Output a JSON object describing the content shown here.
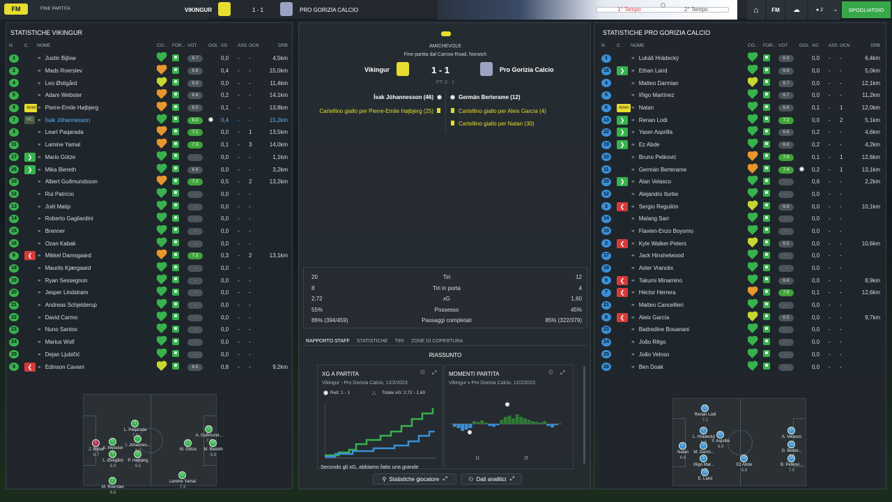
{
  "topbar": {
    "fm_badge": "FM",
    "status": "FINE PARTITA",
    "home_team": "VIKINGUR",
    "score": "1 - 1",
    "away_team": "PRO GORIZIA CALCIO",
    "first_half": "1° Tempo",
    "second_half": "2° Tempo",
    "fm_label": "FM",
    "people_count": "2",
    "dressing_room": "SPOGLIATOIO"
  },
  "columns": {
    "n": "N.",
    "c": "C",
    "name": "NOME",
    "co": "CO...",
    "form": "FOR...",
    "vot": "VOT",
    "gol": "GOL",
    "xg": "XG",
    "ass": "ASS",
    "ocn": "OCN",
    "drb": "DRB"
  },
  "left": {
    "title": "STATISTICHE VIKINGUR",
    "players": [
      {
        "n": "1",
        "name": "Justin Bijlow",
        "vot": "6.7",
        "rg": false,
        "gol": "",
        "xg": "0,0",
        "ass": "-",
        "ocn": "-",
        "drb": "4,5km",
        "heart": "g"
      },
      {
        "n": "2",
        "name": "Mads Roerslev",
        "vot": "6.8",
        "rg": false,
        "gol": "",
        "xg": "0,4",
        "ass": "-",
        "ocn": "-",
        "drb": "15,0km",
        "heart": "o"
      },
      {
        "n": "4",
        "name": "Leo Østigård",
        "vot": "6.9",
        "rg": false,
        "gol": "",
        "xg": "0,0",
        "ass": "-",
        "ocn": "-",
        "drb": "11,4km",
        "heart": "y"
      },
      {
        "n": "5",
        "name": "Adam Webster",
        "vot": "6.6",
        "rg": false,
        "gol": "",
        "xg": "0,2",
        "ass": "-",
        "ocn": "-",
        "drb": "14,1km",
        "heart": "o"
      },
      {
        "n": "8",
        "tag": "Amm",
        "name": "Pierre-Emile Højbjerg",
        "vot": "6.5",
        "rg": false,
        "gol": "",
        "xg": "0,1",
        "ass": "-",
        "ocn": "-",
        "drb": "13,8km",
        "heart": "o"
      },
      {
        "n": "7",
        "tagg": "MC",
        "name": "Ísak Jóhannesson",
        "vot": "8.0",
        "rg": true,
        "gol": "1",
        "xg": "0,4",
        "ass": "-",
        "ocn": "-",
        "drb": "15,2km",
        "heart": "g",
        "hl": true
      },
      {
        "n": "3",
        "name": "Leart Paqarada",
        "vot": "7.1",
        "rg": true,
        "gol": "",
        "xg": "0,0",
        "ass": "-",
        "ocn": "1",
        "drb": "13,5km",
        "heart": "o"
      },
      {
        "n": "11",
        "name": "Lamine Yamal",
        "vot": "7.3",
        "rg": true,
        "gol": "",
        "xg": "0,1",
        "ass": "-",
        "ocn": "3",
        "drb": "14,0km",
        "heart": "o"
      },
      {
        "n": "17",
        "sub": "in",
        "name": "Mario Götze",
        "vot": "-",
        "rg": false,
        "gol": "",
        "xg": "0,0",
        "ass": "-",
        "ocn": "-",
        "drb": "1,1km",
        "heart": "g"
      },
      {
        "n": "26",
        "sub": "in",
        "name": "Mika Biereth",
        "vot": "6.6",
        "rg": false,
        "gol": "",
        "xg": "0,0",
        "ass": "-",
        "ocn": "-",
        "drb": "3,2km",
        "heart": "g"
      },
      {
        "n": "10",
        "name": "Albert Guðmundsson",
        "vot": "7.2",
        "rg": true,
        "gol": "",
        "xg": "0,5",
        "ass": "-",
        "ocn": "2",
        "drb": "13,2km",
        "heart": "o"
      },
      {
        "n": "12",
        "name": "Rui Patrício",
        "vot": "-",
        "rg": false,
        "gol": "",
        "xg": "0,0",
        "ass": "-",
        "ocn": "-",
        "drb": "",
        "heart": "g"
      },
      {
        "n": "13",
        "name": "Joël Matip",
        "vot": "-",
        "rg": false,
        "gol": "",
        "xg": "0,0",
        "ass": "-",
        "ocn": "-",
        "drb": "",
        "heart": "g"
      },
      {
        "n": "14",
        "name": "Roberto Gagliardini",
        "vot": "-",
        "rg": false,
        "gol": "",
        "xg": "0,0",
        "ass": "-",
        "ocn": "-",
        "drb": "",
        "heart": "g"
      },
      {
        "n": "15",
        "name": "Brenner",
        "vot": "-",
        "rg": false,
        "gol": "",
        "xg": "0,0",
        "ass": "-",
        "ocn": "-",
        "drb": "",
        "heart": "g"
      },
      {
        "n": "16",
        "name": "Ozan Kabak",
        "vot": "-",
        "rg": false,
        "gol": "",
        "xg": "0,0",
        "ass": "-",
        "ocn": "-",
        "drb": "",
        "heart": "g"
      },
      {
        "n": "6",
        "sub": "out",
        "name": "Mikkel Damsgaard",
        "vot": "7.2",
        "rg": true,
        "gol": "",
        "xg": "0,3",
        "ass": "-",
        "ocn": "2",
        "drb": "13,1km",
        "heart": "o"
      },
      {
        "n": "18",
        "name": "Maurits Kjærgaard",
        "vot": "-",
        "rg": false,
        "gol": "",
        "xg": "0,0",
        "ass": "-",
        "ocn": "-",
        "drb": "",
        "heart": "g"
      },
      {
        "n": "19",
        "name": "Ryan Sessegnon",
        "vot": "-",
        "rg": false,
        "gol": "",
        "xg": "0,0",
        "ass": "-",
        "ocn": "-",
        "drb": "",
        "heart": "g"
      },
      {
        "n": "20",
        "name": "Jesper Lindstrøm",
        "vot": "-",
        "rg": false,
        "gol": "",
        "xg": "0,0",
        "ass": "-",
        "ocn": "-",
        "drb": "",
        "heart": "g"
      },
      {
        "n": "21",
        "name": "Andreas Schjelderup",
        "vot": "-",
        "rg": false,
        "gol": "",
        "xg": "0,0",
        "ass": "-",
        "ocn": "-",
        "drb": "",
        "heart": "g"
      },
      {
        "n": "22",
        "name": "David Carmo",
        "vot": "-",
        "rg": false,
        "gol": "",
        "xg": "0,0",
        "ass": "-",
        "ocn": "-",
        "drb": "",
        "heart": "g"
      },
      {
        "n": "23",
        "name": "Nuno Santos",
        "vot": "-",
        "rg": false,
        "gol": "",
        "xg": "0,0",
        "ass": "-",
        "ocn": "-",
        "drb": "",
        "heart": "g"
      },
      {
        "n": "24",
        "name": "Marius Wolf",
        "vot": "-",
        "rg": false,
        "gol": "",
        "xg": "0,0",
        "ass": "-",
        "ocn": "-",
        "drb": "",
        "heart": "g"
      },
      {
        "n": "25",
        "name": "Dejan Ljubičić",
        "vot": "-",
        "rg": false,
        "gol": "",
        "xg": "0,0",
        "ass": "-",
        "ocn": "-",
        "drb": "",
        "heart": "g"
      },
      {
        "n": "9",
        "sub": "out",
        "name": "Edinson Cavani",
        "vot": "6.5",
        "rg": false,
        "gol": "",
        "xg": "0,8",
        "ass": "-",
        "ocn": "-",
        "drb": "9,2km",
        "heart": "y"
      }
    ],
    "pitch": [
      {
        "n": "1",
        "name": "J. Bijlow",
        "r": "6.7"
      },
      {
        "n": "3",
        "name": "L. Paqarada",
        "r": "7.1"
      },
      {
        "n": "5",
        "name": "A. Webster",
        "r": "6.6"
      },
      {
        "n": "7",
        "name": "I. Jóhannes...",
        "r": "8.0"
      },
      {
        "n": "4",
        "name": "L. Østigård",
        "r": "6.9"
      },
      {
        "n": "8",
        "name": "P. Højbjerg",
        "r": "6.5"
      },
      {
        "n": "2",
        "name": "M. Roerslev",
        "r": "6.8"
      },
      {
        "n": "10",
        "name": "A. Guðmund...",
        "r": "7.2"
      },
      {
        "n": "17",
        "name": "M. Götze",
        "r": ""
      },
      {
        "n": "26",
        "name": "M. Biereth",
        "r": "6.6"
      },
      {
        "n": "11",
        "name": "Lamine Yamal",
        "r": "7.3"
      }
    ]
  },
  "right": {
    "title": "STATISTICHE PRO GORIZIA CALCIO",
    "players": [
      {
        "n": "1",
        "name": "Lukáš Hrádecký",
        "vot": "6.9",
        "rg": false,
        "gol": "",
        "xg": "0,0",
        "ass": "-",
        "ocn": "-",
        "drb": "6,4km",
        "heart": "g"
      },
      {
        "n": "16",
        "sub": "in",
        "name": "Ethan Laird",
        "vot": "6.6",
        "rg": false,
        "gol": "",
        "xg": "0,0",
        "ass": "-",
        "ocn": "-",
        "drb": "5,0km",
        "heart": "g"
      },
      {
        "n": "4",
        "name": "Matteo Darmian",
        "vot": "6.7",
        "rg": false,
        "gol": "",
        "xg": "0,0",
        "ass": "-",
        "ocn": "-",
        "drb": "12,1km",
        "heart": "y"
      },
      {
        "n": "5",
        "name": "Iñigo Martínez",
        "vot": "6.7",
        "rg": false,
        "gol": "",
        "xg": "0,0",
        "ass": "-",
        "ocn": "-",
        "drb": "11,2km",
        "heart": "g"
      },
      {
        "n": "6",
        "tag": "Amm",
        "name": "Natan",
        "vot": "6.6",
        "rg": false,
        "gol": "",
        "xg": "0,1",
        "ass": "-",
        "ocn": "1",
        "drb": "12,0km",
        "heart": "g"
      },
      {
        "n": "13",
        "sub": "in",
        "name": "Renan Lodi",
        "vot": "7.2",
        "rg": true,
        "gol": "",
        "xg": "0,0",
        "ass": "-",
        "ocn": "2",
        "drb": "5,1km",
        "heart": "g"
      },
      {
        "n": "22",
        "sub": "in",
        "name": "Yaser Asprilla",
        "vot": "6.8",
        "rg": false,
        "gol": "",
        "xg": "0,2",
        "ass": "-",
        "ocn": "-",
        "drb": "4,6km",
        "heart": "g"
      },
      {
        "n": "19",
        "sub": "in",
        "name": "Ez Abde",
        "vot": "6.6",
        "rg": false,
        "gol": "",
        "xg": "0,2",
        "ass": "-",
        "ocn": "-",
        "drb": "4,2km",
        "heart": "g"
      },
      {
        "n": "10",
        "name": "Bruno Petković",
        "vot": "7.0",
        "rg": true,
        "gol": "",
        "xg": "0,1",
        "ass": "-",
        "ocn": "1",
        "drb": "12,6km",
        "heart": "o"
      },
      {
        "n": "11",
        "name": "Germán Berterame",
        "vot": "7.4",
        "rg": true,
        "gol": "1",
        "xg": "0,2",
        "ass": "-",
        "ocn": "1",
        "drb": "13,1km",
        "heart": "o"
      },
      {
        "n": "20",
        "sub": "in",
        "name": "Alan Velasco",
        "vot": "-",
        "rg": false,
        "gol": "",
        "xg": "0,6",
        "ass": "-",
        "ocn": "-",
        "drb": "2,2km",
        "heart": "g"
      },
      {
        "n": "12",
        "name": "Alejandro Iturbe",
        "vot": "-",
        "rg": false,
        "gol": "",
        "xg": "0,0",
        "ass": "-",
        "ocn": "-",
        "drb": "",
        "heart": "g"
      },
      {
        "n": "3",
        "sub": "out",
        "name": "Sergio Reguilón",
        "vot": "6.8",
        "rg": false,
        "gol": "",
        "xg": "0,0",
        "ass": "-",
        "ocn": "-",
        "drb": "10,1km",
        "heart": "y"
      },
      {
        "n": "14",
        "name": "Malang Sarr",
        "vot": "-",
        "rg": false,
        "gol": "",
        "xg": "0,0",
        "ass": "-",
        "ocn": "-",
        "drb": "",
        "heart": "g"
      },
      {
        "n": "15",
        "name": "Flavien-Enzo Boyomo",
        "vot": "-",
        "rg": false,
        "gol": "",
        "xg": "0,0",
        "ass": "-",
        "ocn": "-",
        "drb": "",
        "heart": "g"
      },
      {
        "n": "2",
        "sub": "out",
        "name": "Kyle Walker-Peters",
        "vot": "6.5",
        "rg": false,
        "gol": "",
        "xg": "0,0",
        "ass": "-",
        "ocn": "-",
        "drb": "10,6km",
        "heart": "y"
      },
      {
        "n": "17",
        "name": "Jack Hinshelwood",
        "vot": "-",
        "rg": false,
        "gol": "",
        "xg": "0,0",
        "ass": "-",
        "ocn": "-",
        "drb": "",
        "heart": "g"
      },
      {
        "n": "18",
        "name": "Aster Vranckx",
        "vot": "-",
        "rg": false,
        "gol": "",
        "xg": "0,0",
        "ass": "-",
        "ocn": "-",
        "drb": "",
        "heart": "g"
      },
      {
        "n": "9",
        "sub": "out",
        "name": "Takumi Minamino",
        "vot": "6.6",
        "rg": false,
        "gol": "",
        "xg": "0,0",
        "ass": "-",
        "ocn": "-",
        "drb": "8,9km",
        "heart": "g"
      },
      {
        "n": "7",
        "sub": "out",
        "name": "Héctor Herrera",
        "vot": "7.0",
        "rg": true,
        "gol": "",
        "xg": "0,1",
        "ass": "-",
        "ocn": "-",
        "drb": "12,6km",
        "heart": "o"
      },
      {
        "n": "21",
        "name": "Matteo Cancellieri",
        "vot": "-",
        "rg": false,
        "gol": "",
        "xg": "0,0",
        "ass": "-",
        "ocn": "-",
        "drb": "",
        "heart": "g"
      },
      {
        "n": "8",
        "sub": "out",
        "name": "Aleix García",
        "vot": "6.5",
        "rg": false,
        "gol": "",
        "xg": "0,0",
        "ass": "-",
        "ocn": "-",
        "drb": "9,7km",
        "heart": "y"
      },
      {
        "n": "23",
        "name": "Badredine Bouanani",
        "vot": "-",
        "rg": false,
        "gol": "",
        "xg": "0,0",
        "ass": "-",
        "ocn": "-",
        "drb": "",
        "heart": "g"
      },
      {
        "n": "24",
        "name": "João Rêgo",
        "vot": "-",
        "rg": false,
        "gol": "",
        "xg": "0,0",
        "ass": "-",
        "ocn": "-",
        "drb": "",
        "heart": "g"
      },
      {
        "n": "25",
        "name": "João Veloso",
        "vot": "-",
        "rg": false,
        "gol": "",
        "xg": "0,0",
        "ass": "-",
        "ocn": "-",
        "drb": "",
        "heart": "g"
      },
      {
        "n": "26",
        "name": "Ben Doak",
        "vot": "-",
        "rg": false,
        "gol": "",
        "xg": "0,0",
        "ass": "-",
        "ocn": "-",
        "drb": "",
        "heart": "g"
      }
    ],
    "pitch": [
      {
        "n": "13",
        "name": "Renan Lodi",
        "r": "7.2"
      },
      {
        "n": "6",
        "name": "Natan",
        "r": "6.6"
      },
      {
        "n": "22",
        "name": "Y. Asprilla",
        "r": "6.8"
      },
      {
        "n": "8",
        "name": "L. Hrádecký",
        "r": "6.9"
      },
      {
        "n": "19",
        "name": "Ez Abde",
        "r": "6.6"
      },
      {
        "n": "4",
        "name": "M. Darmi...",
        "r": "6.7"
      },
      {
        "n": "5",
        "name": "Iñigo Mar...",
        "r": "6.7"
      },
      {
        "n": "16",
        "name": "E. Laird",
        "r": ""
      },
      {
        "n": "20",
        "name": "A. Velasco",
        "r": ""
      },
      {
        "n": "11",
        "name": "G. Berter...",
        "r": "7.4"
      },
      {
        "n": "10",
        "name": "B. Petkovi...",
        "r": "7.0"
      }
    ]
  },
  "center": {
    "competition": "AMICHEVOLE",
    "venue": "Fine partita dal Carrow Road, Norwich",
    "home": "Vikingur",
    "score": "1 - 1",
    "away": "Pro Gorizia Calcio",
    "ht": "PT: 0 - 1",
    "events_home": [
      "Ísak Jóhannesson (46)",
      "Cartellino giallo per Pierre-Emile Højbjerg (25)"
    ],
    "events_away": [
      "Germán Berterame (12)",
      "Cartellino giallo per Aleix García (4)",
      "Cartellino giallo per Natan (30)"
    ],
    "stats": [
      {
        "h": "20",
        "label": "Tiri",
        "a": "12"
      },
      {
        "h": "8",
        "label": "Tiri in porta",
        "a": "4"
      },
      {
        "h": "2,72",
        "label": "xG",
        "a": "1,60"
      },
      {
        "h": "55%",
        "label": "Possesso",
        "a": "45%"
      },
      {
        "h": "86% (394/459)",
        "label": "Passaggi completati",
        "a": "85% (322/379)"
      }
    ],
    "tabs": [
      "RAPPORTO STAFF",
      "STATISTICHE",
      "TIRI",
      "ZONE DI COPERTURA"
    ],
    "summary_title": "RIASSUNTO",
    "xg_card": {
      "title": "XG A PARTITA",
      "subtitle": "Vikingur - Pro Gorizia Calcio, 12/2/2023",
      "goals": "Reti: 1 - 1",
      "total": "Totale xG: 2.72 - 1.60",
      "caption": "Secondo gli xG, abbiamo fatto una grande"
    },
    "moments_card": {
      "title": "MOMENTI PARTITA",
      "subtitle": "Vikingur v Pro Gorizia Calcio, 12/2/2023",
      "x1": "1t",
      "x2": "2t"
    },
    "btn_player_stats": "Statistiche giocatore",
    "btn_data_analysts": "Dati analitici"
  },
  "colors": {
    "green": "#37b24d",
    "blue": "#3b8fd7",
    "red": "#d63b3b",
    "yellow": "#e6dd2e",
    "orange": "#e8962d"
  }
}
